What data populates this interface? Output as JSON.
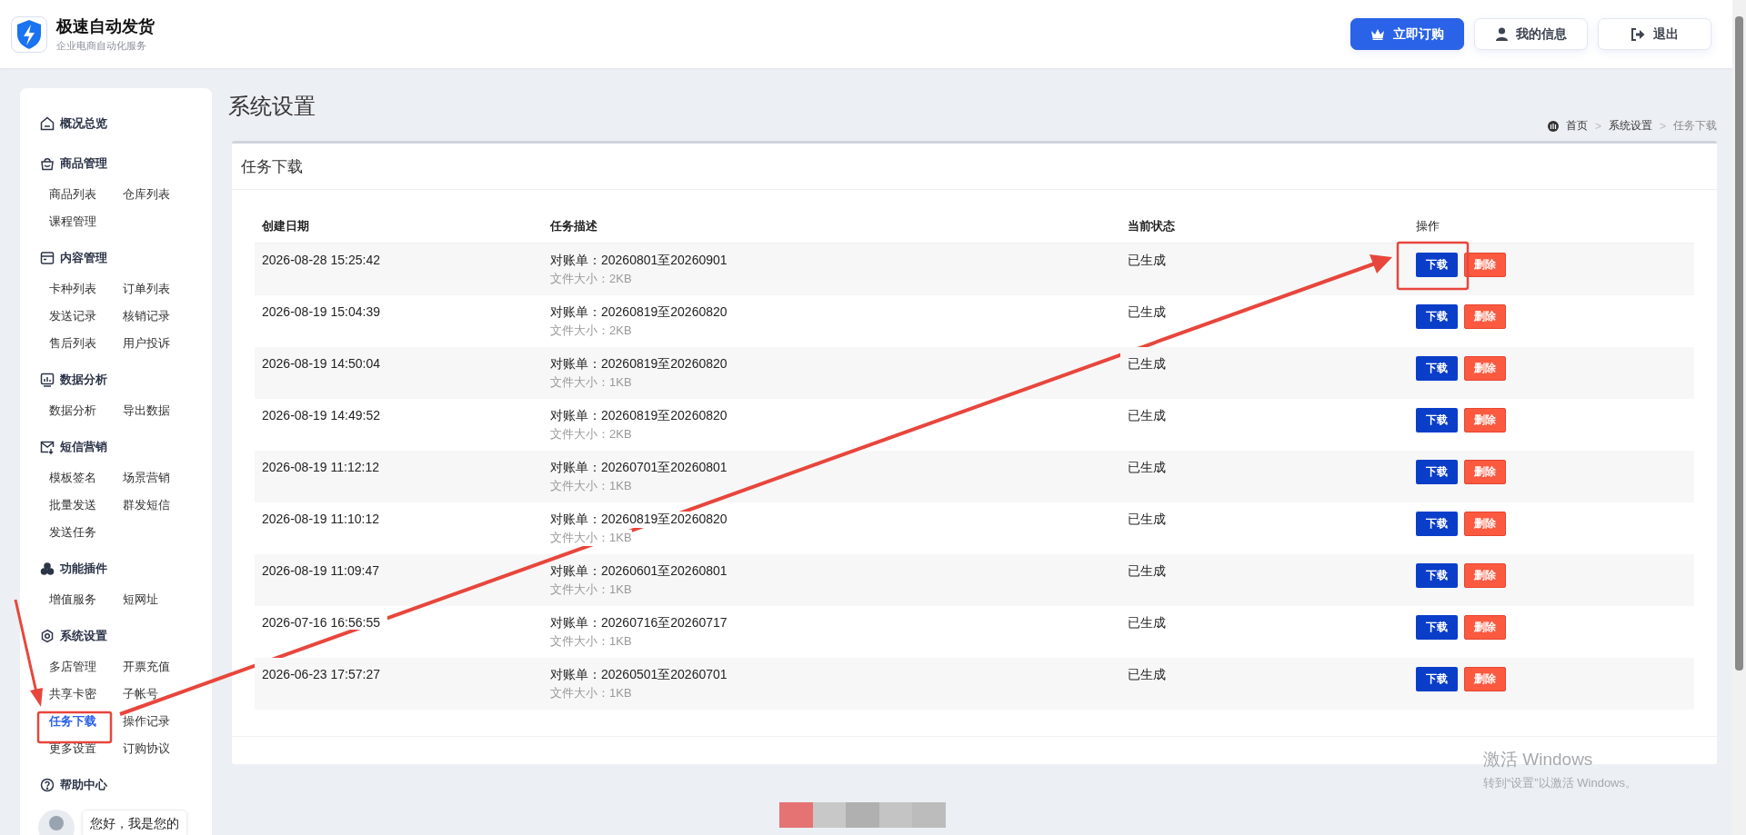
{
  "app": {
    "name": "极速自动发货",
    "tagline": "企业电商自动化服务"
  },
  "header_buttons": [
    {
      "label": "立即订购",
      "kind": "primary"
    },
    {
      "label": "我的信息",
      "kind": "user"
    },
    {
      "label": "退出",
      "kind": "logout"
    }
  ],
  "sidebar": [
    {
      "title": "概况总览",
      "kind": "home"
    },
    {
      "title": "商品管理",
      "kind": "bag",
      "items": [
        {
          "label": "商品列表",
          "selected": false
        },
        {
          "label": "仓库列表",
          "selected": false
        },
        {
          "label": "课程管理",
          "selected": false
        }
      ]
    },
    {
      "title": "内容管理",
      "kind": "card",
      "items": [
        {
          "label": "卡种列表",
          "selected": false
        },
        {
          "label": "订单列表",
          "selected": false
        },
        {
          "label": "发送记录",
          "selected": false
        },
        {
          "label": "核销记录",
          "selected": false
        },
        {
          "label": "售后列表",
          "selected": false
        },
        {
          "label": "用户投诉",
          "selected": false
        }
      ]
    },
    {
      "title": "数据分析",
      "kind": "chart",
      "items": [
        {
          "label": "数据分析",
          "selected": false
        },
        {
          "label": "导出数据",
          "selected": false
        }
      ]
    },
    {
      "title": "短信营销",
      "kind": "mail",
      "items": [
        {
          "label": "模板签名",
          "selected": false
        },
        {
          "label": "场景营销",
          "selected": false
        },
        {
          "label": "批量发送",
          "selected": false
        },
        {
          "label": "群发短信",
          "selected": false
        },
        {
          "label": "发送任务",
          "selected": false
        }
      ]
    },
    {
      "title": "功能插件",
      "kind": "plugin",
      "items": [
        {
          "label": "增值服务",
          "selected": false
        },
        {
          "label": "短网址",
          "selected": false
        }
      ]
    },
    {
      "title": "系统设置",
      "kind": "gear",
      "items": [
        {
          "label": "多店管理",
          "selected": false
        },
        {
          "label": "开票充值",
          "selected": false
        },
        {
          "label": "共享卡密",
          "selected": false
        },
        {
          "label": "子帐号",
          "selected": false
        },
        {
          "label": "任务下载",
          "selected": true
        },
        {
          "label": "操作记录",
          "selected": false
        },
        {
          "label": "更多设置",
          "selected": false
        },
        {
          "label": "订购协议",
          "selected": false
        }
      ]
    },
    {
      "title": "帮助中心",
      "kind": "help"
    }
  ],
  "assistant": {
    "greeting": "您好，我是您的"
  },
  "page_title": "系统设置",
  "breadcrumb": {
    "items": [
      "首页",
      "系统设置",
      "任务下载"
    ],
    "separator": ">"
  },
  "panel_title": "任务下载",
  "table": {
    "columns": [
      "创建日期",
      "任务描述",
      "当前状态",
      "操作"
    ],
    "rows": [
      {
        "date": "2026-08-28 15:25:42",
        "description": "对账单：20260801至20260901",
        "size": "文件大小：2KB",
        "status": "已生成",
        "actions": [
          {
            "label": "下载",
            "kind": "download"
          },
          {
            "label": "删除",
            "kind": "delete"
          }
        ]
      },
      {
        "date": "2026-08-19 15:04:39",
        "description": "对账单：20260819至20260820",
        "size": "文件大小：2KB",
        "status": "已生成",
        "actions": [
          {
            "label": "下载",
            "kind": "download"
          },
          {
            "label": "删除",
            "kind": "delete"
          }
        ]
      },
      {
        "date": "2026-08-19 14:50:04",
        "description": "对账单：20260819至20260820",
        "size": "文件大小：1KB",
        "status": "已生成",
        "actions": [
          {
            "label": "下载",
            "kind": "download"
          },
          {
            "label": "删除",
            "kind": "delete"
          }
        ]
      },
      {
        "date": "2026-08-19 14:49:52",
        "description": "对账单：20260819至20260820",
        "size": "文件大小：2KB",
        "status": "已生成",
        "actions": [
          {
            "label": "下载",
            "kind": "download"
          },
          {
            "label": "删除",
            "kind": "delete"
          }
        ]
      },
      {
        "date": "2026-08-19 11:12:12",
        "description": "对账单：20260701至20260801",
        "size": "文件大小：1KB",
        "status": "已生成",
        "actions": [
          {
            "label": "下载",
            "kind": "download"
          },
          {
            "label": "删除",
            "kind": "delete"
          }
        ]
      },
      {
        "date": "2026-08-19 11:10:12",
        "description": "对账单：20260819至20260820",
        "size": "文件大小：1KB",
        "status": "已生成",
        "actions": [
          {
            "label": "下载",
            "kind": "download"
          },
          {
            "label": "删除",
            "kind": "delete"
          }
        ]
      },
      {
        "date": "2026-08-19 11:09:47",
        "description": "对账单：20260601至20260801",
        "size": "文件大小：1KB",
        "status": "已生成",
        "actions": [
          {
            "label": "下载",
            "kind": "download"
          },
          {
            "label": "删除",
            "kind": "delete"
          }
        ]
      },
      {
        "date": "2026-07-16 16:56:55",
        "description": "对账单：20260716至20260717",
        "size": "文件大小：1KB",
        "status": "已生成",
        "actions": [
          {
            "label": "下载",
            "kind": "download"
          },
          {
            "label": "删除",
            "kind": "delete"
          }
        ]
      },
      {
        "date": "2026-06-23 17:57:27",
        "description": "对账单：20260501至20260701",
        "size": "文件大小：1KB",
        "status": "已生成",
        "actions": [
          {
            "label": "下载",
            "kind": "download"
          },
          {
            "label": "删除",
            "kind": "delete"
          }
        ]
      }
    ]
  },
  "os_notice": {
    "title": "激活 Windows",
    "subtitle": "转到“设置”以激活 Windows。"
  }
}
